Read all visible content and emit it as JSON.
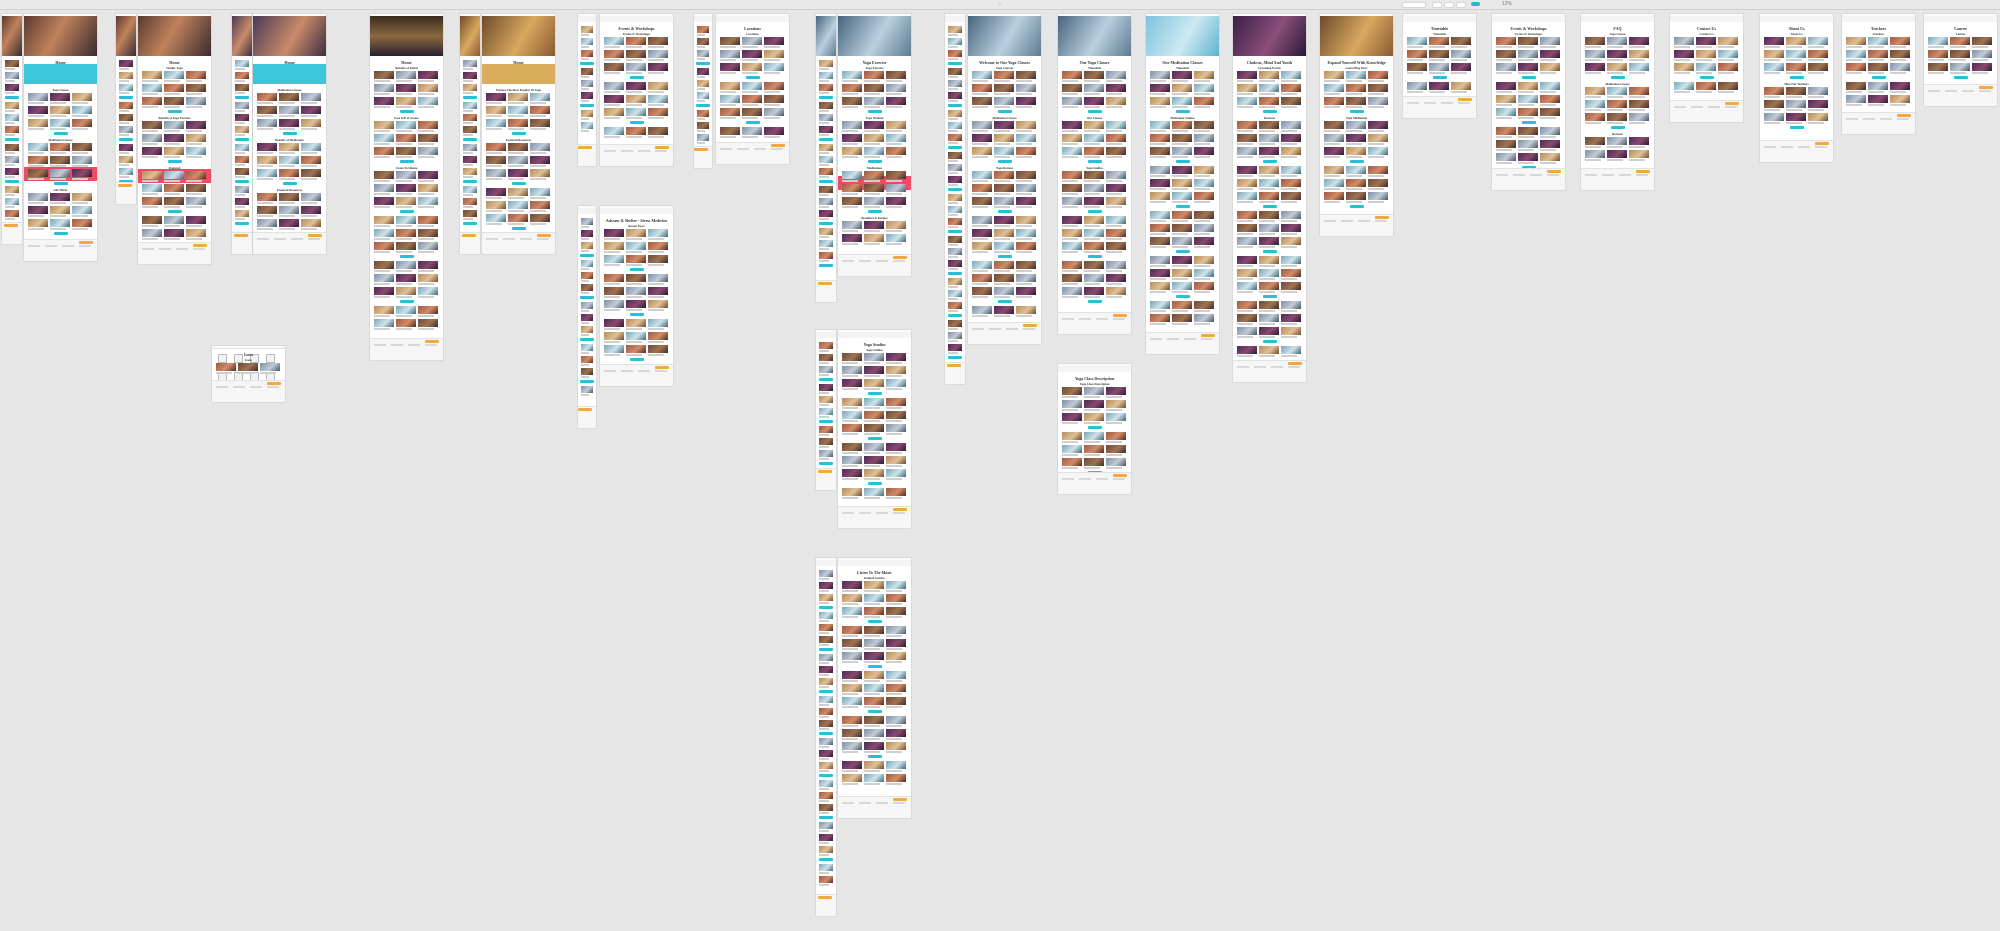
{
  "app": {
    "canvas_bg": "#e6e6e6",
    "topbar_center": "⌂",
    "zoom": "12%",
    "share_color": "#2fb3d0"
  },
  "colors": {
    "cyan": "#26c1d6",
    "orange": "#f2a93b",
    "pink": "#ee4b65",
    "purple": "#4b2a58",
    "gold": "#d5a44a",
    "skyblue": "#5ec7dd"
  },
  "artboards": [
    {
      "id": "home-mobile",
      "title": "Home",
      "sections": [
        "Yoga Classes",
        "Meditation Classes",
        "Life Hacks",
        "Featured Recipes"
      ]
    },
    {
      "id": "home-1",
      "title": "Home",
      "sections": [
        "Yoga Classes",
        "Meditation Classes",
        "Life Hacks",
        "Featured Recipes"
      ]
    },
    {
      "id": "home-2",
      "title": "Home",
      "sections": [
        "Weekly Yoga",
        "Benefits of Yoga Exercise",
        "Featured"
      ]
    },
    {
      "id": "home-3",
      "title": "Home",
      "sections": [
        "Meditation Classes",
        "Benefits of Meditation",
        "Featured Resources"
      ]
    },
    {
      "id": "home-4",
      "title": "Home",
      "sections": [
        "Benefits of Ritual",
        "Free Gift of Aroma",
        "Listen To Silence"
      ]
    },
    {
      "id": "home-5",
      "title": "Home",
      "sections": [
        "Explore The Most Popular Of Yoga",
        "Featured Resources"
      ]
    },
    {
      "id": "events",
      "title": "Events & Workshops",
      "sections": [
        "Events & Workshops"
      ]
    },
    {
      "id": "locations",
      "title": "Locations",
      "sections": [
        "Locations"
      ]
    },
    {
      "id": "yoga-exercise",
      "title": "Yoga Exercise",
      "sections": [
        "Yoga Exercise",
        "Yoga Wisdom",
        "Meditations",
        "Breakfast & Recipes"
      ]
    },
    {
      "id": "yoga-classes",
      "title": "Welcome to Our Yoga Classes",
      "sections": [
        "Yoga Courses",
        "Meditation Classes",
        "Yoga Retreat"
      ]
    },
    {
      "id": "our-yoga-classes",
      "title": "Our Yoga Classes",
      "sections": [
        "Timetable",
        "Our Classes",
        "Yoga Studios"
      ]
    },
    {
      "id": "meditation-classes",
      "title": "Our Meditation Classes",
      "sections": [
        "Timetable",
        "Meditation Studios"
      ]
    },
    {
      "id": "chakras",
      "title": "Chakras, Mind And Youth",
      "sections": [
        "Upcoming Events",
        "Retreats"
      ]
    },
    {
      "id": "expand",
      "title": "Expand Yourself With Knowledge",
      "sections": [
        "Latest Blog Posts",
        "Yoga Meditation"
      ]
    },
    {
      "id": "timetable",
      "title": "Timetable",
      "sections": [
        "Timetable"
      ]
    },
    {
      "id": "events-2",
      "title": "Events & Workshops",
      "sections": [
        "Events & Workshops"
      ]
    },
    {
      "id": "faq",
      "title": "FAQ",
      "sections": [
        "Yoga Classes",
        "Meditation Classes",
        "Retreats"
      ]
    },
    {
      "id": "contact",
      "title": "Contact Us",
      "sections": [
        "Contact Us"
      ]
    },
    {
      "id": "about",
      "title": "About Us",
      "sections": [
        "About Us",
        "Meet Our Teachers"
      ]
    },
    {
      "id": "teachers",
      "title": "Teachers",
      "sections": [
        "Teachers"
      ]
    },
    {
      "id": "teacher-single",
      "title": "Lauren",
      "sections": [
        "Lauren"
      ]
    },
    {
      "id": "article",
      "title": "Ashram & Shelter - Stress Medicine",
      "sections": [
        "Recent Posts"
      ]
    },
    {
      "id": "yoga-studios",
      "title": "Yoga Studios",
      "sections": [
        "Yoga Studios"
      ]
    },
    {
      "id": "blog-single",
      "title": "Listen To The Music",
      "sections": [
        "Related Articles"
      ]
    },
    {
      "id": "yoga-class-desc",
      "title": "Yoga Class Description",
      "sections": [
        "Yoga Class Description"
      ]
    },
    {
      "id": "icons",
      "title": "Icons",
      "sections": [
        "Icons"
      ]
    }
  ],
  "footer": {
    "label": "Subscribe to our newsletter"
  }
}
